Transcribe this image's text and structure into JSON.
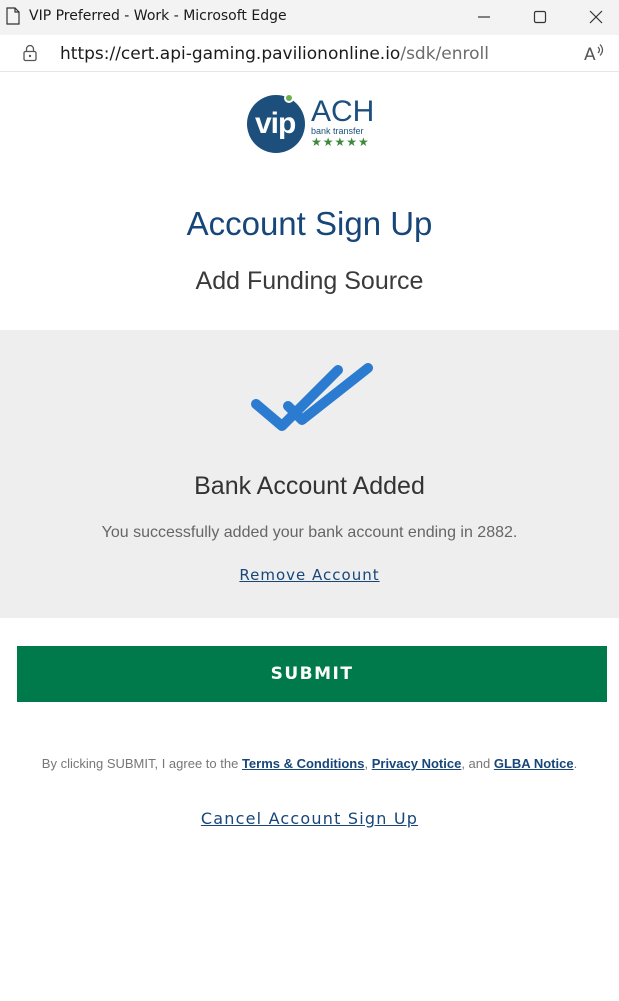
{
  "window": {
    "title": "VIP Preferred - Work - Microsoft Edge"
  },
  "address_bar": {
    "url_main": "https://cert.api-gaming.pavilionon",
    "url_rest": "line.io",
    "url_path": "/sdk/enroll"
  },
  "logo": {
    "vip": "vip",
    "ach": "ACH",
    "tagline": "bank transfer",
    "stars": "★★★★★"
  },
  "page": {
    "title": "Account Sign Up",
    "subtitle": "Add Funding Source"
  },
  "panel": {
    "title": "Bank Account Added",
    "message": "You successfully added your bank account ending in 2882.",
    "remove_link": "Remove Account"
  },
  "submit_label": "SUBMIT",
  "agreement": {
    "prefix": "By clicking SUBMIT, I agree to the ",
    "terms": "Terms & Conditions",
    "sep1": ", ",
    "privacy": "Privacy Notice",
    "sep2": ", and ",
    "glba": "GLBA Notice",
    "suffix": "."
  },
  "cancel_link": "Cancel Account Sign Up",
  "colors": {
    "brand_blue": "#17467a",
    "submit_green": "#007a4b",
    "check_blue": "#2b7bd1",
    "panel_gray": "#eeeeee"
  }
}
